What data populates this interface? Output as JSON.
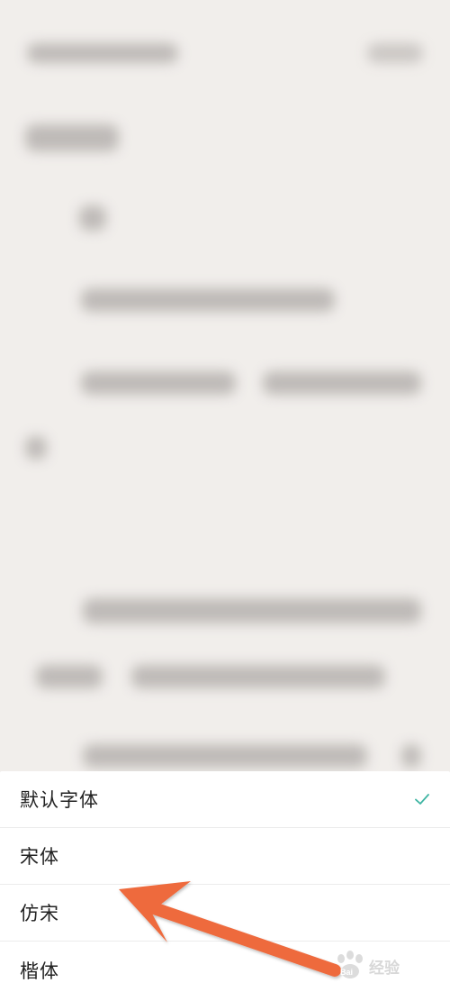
{
  "font_menu": {
    "options": [
      {
        "label": "默认字体",
        "selected": true
      },
      {
        "label": "宋体",
        "selected": false
      },
      {
        "label": "仿宋",
        "selected": false
      },
      {
        "label": "楷体",
        "selected": false
      }
    ],
    "check_color": "#3fb5a3"
  },
  "annotation": {
    "arrow_color": "#ee6a3d"
  },
  "watermark": {
    "text": "经验",
    "logo_text": "Bai"
  },
  "colors": {
    "background": "#f1eeeb",
    "sheet": "#ffffff"
  }
}
